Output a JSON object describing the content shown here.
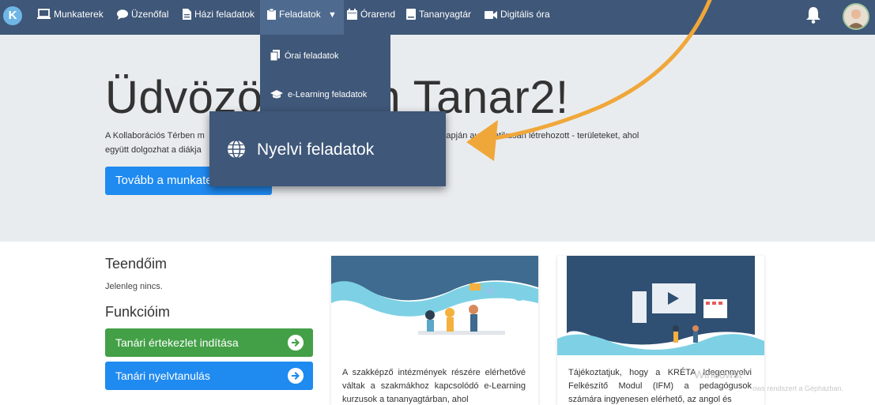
{
  "navbar": {
    "logo_letter": "K",
    "items": [
      {
        "label": "Munkaterek",
        "icon": "laptop-icon"
      },
      {
        "label": "Üzenőfal",
        "icon": "chat-icon"
      },
      {
        "label": "Házi feladatok",
        "icon": "file-icon"
      },
      {
        "label": "Feladatok",
        "icon": "clipboard-icon"
      },
      {
        "label": "Órarend",
        "icon": "calendar-icon"
      },
      {
        "label": "Tananyagtár",
        "icon": "book-icon"
      },
      {
        "label": "Digitális óra",
        "icon": "video-icon"
      }
    ],
    "dropdown_caret": "▼"
  },
  "dropdown": {
    "items": [
      {
        "label": "Órai feladatok",
        "icon": "copy-icon"
      },
      {
        "label": "e-Learning feladatok",
        "icon": "graduation-cap-icon"
      },
      {
        "label": "Nyelvi feladatok",
        "icon": "globe-icon"
      }
    ]
  },
  "hero": {
    "title": "Üdvözöli  opan Tanar2!",
    "text_line1": "A Kollaborációs Térben m                                                         ása va           olt          ak alapján automatikusan létrehozott - területeket, ahol",
    "text_line2": "együtt dolgozhat a diákja",
    "button_label": "Tovább a munkate"
  },
  "todos": {
    "heading": "Teendőim",
    "empty_text": "Jelenleg nincs."
  },
  "functions": {
    "heading": "Funkcióim",
    "buttons": [
      {
        "label": "Tanári értekezlet indítása",
        "color": "#43a047"
      },
      {
        "label": "Tanári nyelvtanulás",
        "color": "#1f8af0"
      }
    ]
  },
  "cards": [
    {
      "text": "A szakképző intézmények részére elérhetővé váltak a szakmákhoz kapcsolódó e-Learning kurzusok a tananyagtárban, ahol"
    },
    {
      "text": "Tájékoztatjuk, hogy a KRÉTA Idegennyelvi Felkészítő Modul (IFM) a pedagógusok számára ingyenesen elérhető, az angol és"
    }
  ],
  "watermark": {
    "line1": "Windowst",
    "line2": "ows rendszert a Gépházban."
  },
  "colors": {
    "navbar": "#3f5778",
    "accent_blue": "#1f8af0",
    "accent_green": "#43a047",
    "annotation_arrow": "#f0a73a"
  }
}
